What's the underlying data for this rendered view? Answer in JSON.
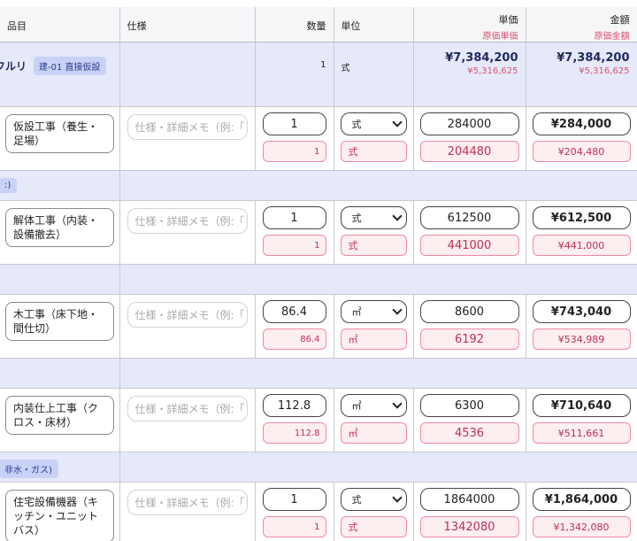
{
  "headers": {
    "item": "品目",
    "spec": "仕様",
    "qty": "数量",
    "unit": "単位",
    "unit_price": "単価",
    "unit_price_orig": "原価単価",
    "amount": "金額",
    "amount_orig": "原価金額"
  },
  "group": {
    "name": "フルリ",
    "badge": "建-01 直接仮設",
    "qty": "1",
    "unit": "式",
    "price": "¥7,384,200",
    "price_orig": "¥5,316,625",
    "amount": "¥7,384,200",
    "amount_orig": "¥5,316,625"
  },
  "categories": [
    {
      "label": "ː)"
    },
    {
      "label": ""
    },
    {
      "label": ""
    },
    {
      "label": "非水・ガス)"
    }
  ],
  "memo_placeholder": "仕様・詳細メモ（例:「",
  "items": [
    {
      "name": "仮設工事（養生・足場）",
      "qty": "1",
      "unit": "式",
      "price": "284000",
      "amount": "¥284,000",
      "qty_orig": "1",
      "unit_orig": "式",
      "price_orig": "204480",
      "amount_orig": "¥204,480"
    },
    {
      "name": "解体工事（内装・設備撤去）",
      "qty": "1",
      "unit": "式",
      "price": "612500",
      "amount": "¥612,500",
      "qty_orig": "1",
      "unit_orig": "式",
      "price_orig": "441000",
      "amount_orig": "¥441,000"
    },
    {
      "name": "木工事（床下地・間仕切）",
      "qty": "86.4",
      "unit": "㎡",
      "price": "8600",
      "amount": "¥743,040",
      "qty_orig": "86.4",
      "unit_orig": "㎡",
      "price_orig": "6192",
      "amount_orig": "¥534,989"
    },
    {
      "name": "内装仕上工事（クロス・床材）",
      "qty": "112.8",
      "unit": "㎡",
      "price": "6300",
      "amount": "¥710,640",
      "qty_orig": "112.8",
      "unit_orig": "㎡",
      "price_orig": "4536",
      "amount_orig": "¥511,661"
    },
    {
      "name": "住宅設備機器（キッチン・ユニットバス）",
      "qty": "1",
      "unit": "式",
      "price": "1864000",
      "amount": "¥1,864,000",
      "qty_orig": "1",
      "unit_orig": "式",
      "price_orig": "1342080",
      "amount_orig": "¥1,342,080"
    }
  ],
  "colors": {
    "group_bg": "#e6e9f9",
    "badge_bg": "#c9d2f6",
    "orig_text": "#d9536e",
    "orig_field_bg": "#fdeef0",
    "orig_field_border": "#f08aa0"
  }
}
